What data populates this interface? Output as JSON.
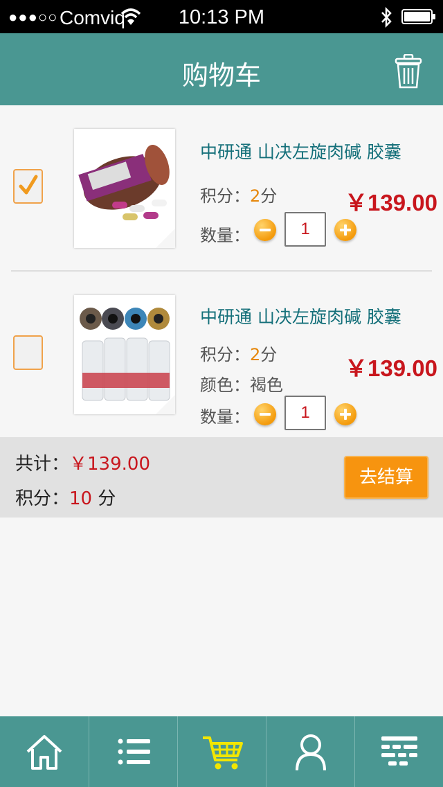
{
  "status_bar": {
    "signal": "●●●○○",
    "carrier": "Comviq",
    "time": "10:13 PM"
  },
  "header": {
    "title": "购物车",
    "delete_icon": "trash-icon"
  },
  "cart": {
    "items": [
      {
        "checked": true,
        "name": "中研通 山决左旋肉碱 胶囊",
        "points_label": "积分：",
        "points_value": "2",
        "points_unit": "分",
        "price": "￥139.00",
        "quantity_label": "数量：",
        "quantity": "1"
      },
      {
        "checked": false,
        "name": "中研通 山决左旋肉碱 胶囊",
        "points_label": "积分：",
        "points_value": "2",
        "points_unit": "分",
        "color_label": "颜色：",
        "color_value": "褐色",
        "price": "￥139.00",
        "quantity_label": "数量：",
        "quantity": "1"
      }
    ]
  },
  "summary": {
    "total_label": "共计：",
    "total_value": "￥139.00",
    "points_label": "积分：",
    "points_value": "10",
    "points_unit": " 分",
    "checkout_label": "去结算"
  },
  "tab_bar": {
    "items": [
      {
        "icon": "home-icon",
        "active": false
      },
      {
        "icon": "list-icon",
        "active": false
      },
      {
        "icon": "cart-icon",
        "active": true
      },
      {
        "icon": "user-icon",
        "active": false
      },
      {
        "icon": "menu-grid-icon",
        "active": false
      }
    ]
  },
  "colors": {
    "theme": "#4a9792",
    "price_red": "#c8161d",
    "accent_orange": "#f7940f",
    "active_tab": "#f2e600"
  }
}
